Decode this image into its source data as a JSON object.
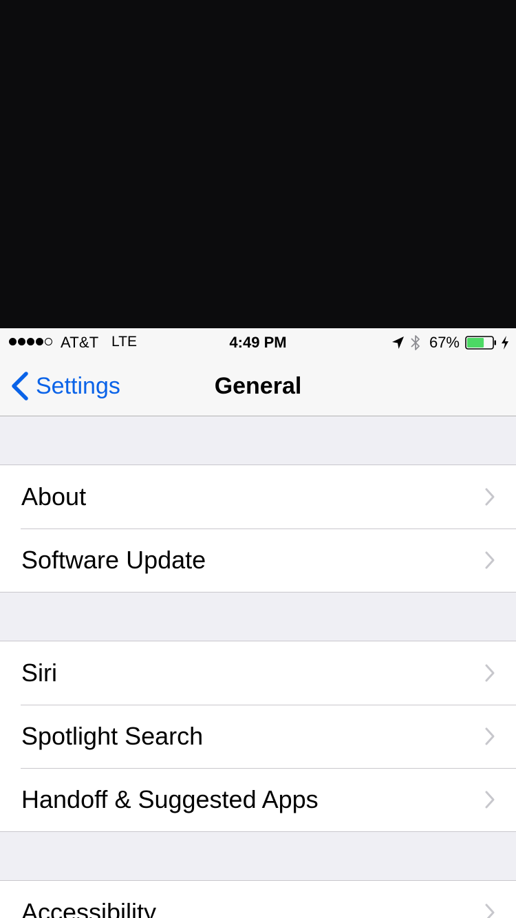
{
  "status_bar": {
    "carrier": "AT&T",
    "network": "LTE",
    "time": "4:49 PM",
    "battery_percent": "67%",
    "battery_level": 0.67,
    "signal_bars_filled": 4,
    "signal_bars_total": 5,
    "icons": [
      "location-arrow-icon",
      "bluetooth-icon",
      "battery-icon",
      "charging-bolt-icon"
    ]
  },
  "nav": {
    "back_label": "Settings",
    "title": "General"
  },
  "groups": [
    {
      "items": [
        {
          "label": "About"
        },
        {
          "label": "Software Update"
        }
      ]
    },
    {
      "items": [
        {
          "label": "Siri"
        },
        {
          "label": "Spotlight Search"
        },
        {
          "label": "Handoff & Suggested Apps"
        }
      ]
    },
    {
      "items": [
        {
          "label": "Accessibility"
        }
      ]
    }
  ],
  "colors": {
    "accent": "#0a63e8",
    "battery_fill": "#4cd964",
    "background": "#efeff4",
    "separator": "#c8c7cc",
    "chevron": "#c7c7cc"
  }
}
